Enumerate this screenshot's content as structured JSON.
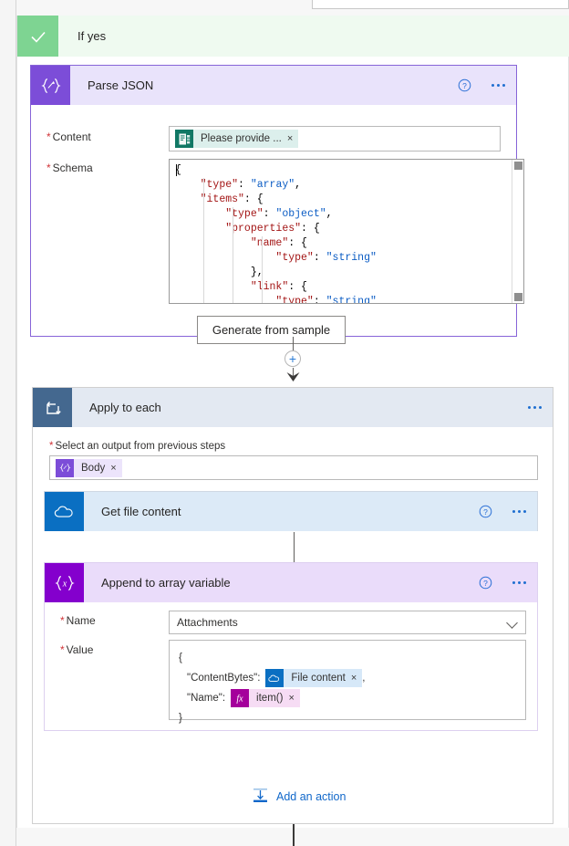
{
  "branch": {
    "label": "If yes",
    "icon": "check-icon"
  },
  "parse_json": {
    "title": "Parse JSON",
    "icon": "json-braces-icon",
    "help_icon": "help-circle-icon",
    "more_icon": "ellipsis-icon",
    "content_field": {
      "label": "Content",
      "required": true,
      "token": {
        "text": "Please provide ...",
        "icon": "microsoft-forms-icon",
        "remove": "×"
      }
    },
    "schema_field": {
      "label": "Schema",
      "required": true,
      "lines": [
        [
          {
            "t": "{",
            "c": "p"
          }
        ],
        [
          {
            "t": "    ",
            "c": "p"
          },
          {
            "t": "\"type\"",
            "c": "k"
          },
          {
            "t": ": ",
            "c": "p"
          },
          {
            "t": "\"array\"",
            "c": "v"
          },
          {
            "t": ",",
            "c": "p"
          }
        ],
        [
          {
            "t": "    ",
            "c": "p"
          },
          {
            "t": "\"items\"",
            "c": "k"
          },
          {
            "t": ": {",
            "c": "p"
          }
        ],
        [
          {
            "t": "        ",
            "c": "p"
          },
          {
            "t": "\"type\"",
            "c": "k"
          },
          {
            "t": ": ",
            "c": "p"
          },
          {
            "t": "\"object\"",
            "c": "v"
          },
          {
            "t": ",",
            "c": "p"
          }
        ],
        [
          {
            "t": "        ",
            "c": "p"
          },
          {
            "t": "\"properties\"",
            "c": "k"
          },
          {
            "t": ": {",
            "c": "p"
          }
        ],
        [
          {
            "t": "            ",
            "c": "p"
          },
          {
            "t": "\"name\"",
            "c": "k"
          },
          {
            "t": ": {",
            "c": "p"
          }
        ],
        [
          {
            "t": "                ",
            "c": "p"
          },
          {
            "t": "\"type\"",
            "c": "k"
          },
          {
            "t": ": ",
            "c": "p"
          },
          {
            "t": "\"string\"",
            "c": "v"
          }
        ],
        [
          {
            "t": "            },",
            "c": "p"
          }
        ],
        [
          {
            "t": "            ",
            "c": "p"
          },
          {
            "t": "\"link\"",
            "c": "k"
          },
          {
            "t": ": {",
            "c": "p"
          }
        ],
        [
          {
            "t": "                ",
            "c": "p"
          },
          {
            "t": "\"type\"",
            "c": "k"
          },
          {
            "t": ": ",
            "c": "p"
          },
          {
            "t": "\"string\"",
            "c": "v"
          }
        ]
      ]
    },
    "generate_button": "Generate from sample"
  },
  "connector": {
    "plus_label": "+",
    "plus_icon": "add-step-icon"
  },
  "apply_to_each": {
    "title": "Apply to each",
    "icon": "loop-icon",
    "more_icon": "ellipsis-icon",
    "select_field": {
      "label": "Select an output from previous steps",
      "required": true,
      "token": {
        "text": "Body",
        "icon": "json-braces-icon",
        "remove": "×"
      }
    },
    "add_action": {
      "label": "Add an action",
      "icon": "add-action-icon"
    }
  },
  "get_file_content": {
    "title": "Get file content",
    "icon": "onedrive-icon",
    "help_icon": "help-circle-icon",
    "more_icon": "ellipsis-icon"
  },
  "append_to_array": {
    "title": "Append to array variable",
    "icon": "variable-braces-icon",
    "help_icon": "help-circle-icon",
    "more_icon": "ellipsis-icon",
    "name_field": {
      "label": "Name",
      "required": true,
      "value": "Attachments",
      "chevron_icon": "chevron-down-icon"
    },
    "value_field": {
      "label": "Value",
      "required": true,
      "line_open": "{",
      "line_close": "}",
      "content_bytes_key": "\"ContentBytes\":",
      "content_bytes_token": {
        "text": "File content",
        "icon": "onedrive-icon",
        "remove": "×"
      },
      "content_bytes_comma": ",",
      "name_key": "\"Name\":",
      "name_token": {
        "text": "item()",
        "icon": "function-fx-icon",
        "remove": "×"
      }
    }
  },
  "colors": {
    "branch_green": "#7ed492",
    "branch_bg": "#effaf0",
    "parse_purple": "#7c4dd8",
    "parse_header": "#e9e3fb",
    "loop_blue": "#44688f",
    "loop_header": "#e3e9f2",
    "onedrive_blue": "#0a6fc2",
    "onedrive_header": "#dceaf7",
    "variable_purple": "#8400cd",
    "variable_header": "#eadcfa",
    "link_blue": "#1168ca",
    "required_red": "#d13438",
    "code_key": "#a31515",
    "code_value": "#0b5cc4"
  }
}
